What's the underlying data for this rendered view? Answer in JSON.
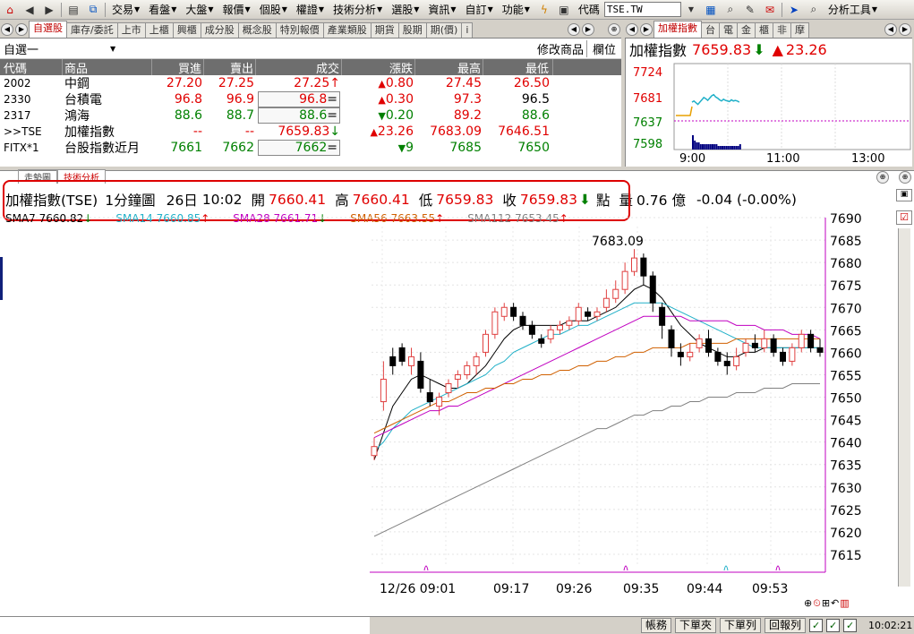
{
  "toolbar": {
    "menus": [
      "交易",
      "看盤",
      "大盤",
      "報價",
      "個股",
      "權證",
      "技術分析",
      "選股",
      "資訊",
      "自訂",
      "功能"
    ],
    "code_label": "代碼",
    "code_value": "TSE.TW",
    "analysis_tools": "分析工具"
  },
  "quote_tabs": [
    "自選股",
    "庫存/委託",
    "上市",
    "上櫃",
    "興櫃",
    "成分股",
    "概念股",
    "特別報價",
    "產業類股",
    "期貨",
    "股期",
    "期(價)",
    "i"
  ],
  "quote_header": {
    "group": "自選一",
    "modify": "修改商品",
    "columns_btn": "欄位"
  },
  "quote_columns": [
    "代碼",
    "商品",
    "買進",
    "賣出",
    "成交",
    "漲跌",
    "最高",
    "最低"
  ],
  "quote_rows": [
    {
      "code": "2002",
      "name": "中鋼",
      "bid": "27.20",
      "ask": "27.25",
      "last": "27.25",
      "last_mark": "↑",
      "chg": "0.80",
      "chg_dir": "up",
      "high": "27.45",
      "low": "26.50",
      "color": "red",
      "hc": "red",
      "lc": "red"
    },
    {
      "code": "2330",
      "name": "台積電",
      "bid": "96.8",
      "ask": "96.9",
      "last": "96.8",
      "last_mark": "=",
      "chg": "0.30",
      "chg_dir": "up",
      "high": "97.3",
      "low": "96.5",
      "color": "red",
      "hc": "red",
      "lc": "blk"
    },
    {
      "code": "2317",
      "name": "鴻海",
      "bid": "88.6",
      "ask": "88.7",
      "last": "88.6",
      "last_mark": "=",
      "chg": "0.20",
      "chg_dir": "down",
      "high": "89.2",
      "low": "88.6",
      "color": "grn",
      "hc": "red",
      "lc": "grn"
    },
    {
      "code": ">>TSE",
      "name": "加權指數",
      "bid": "--",
      "ask": "--",
      "last": "7659.83",
      "last_mark": "↓",
      "chg": "23.26",
      "chg_dir": "up",
      "high": "7683.09",
      "low": "7646.51",
      "color": "red",
      "hc": "red",
      "lc": "red"
    },
    {
      "code": "FITX*1",
      "name": "台股指數近月",
      "bid": "7661",
      "ask": "7662",
      "last": "7662",
      "last_mark": "=",
      "chg": "9",
      "chg_dir": "down",
      "high": "7685",
      "low": "7650",
      "color": "grn",
      "hc": "grn",
      "lc": "grn"
    }
  ],
  "mini_tabs": [
    "加權指數",
    "台",
    "電",
    "金",
    "櫃",
    "非",
    "摩"
  ],
  "mini_header": {
    "name": "加權指數",
    "price": "7659.83",
    "change": "23.26"
  },
  "mini_axis": {
    "y": [
      "7724",
      "7681",
      "7637",
      "7598"
    ],
    "x": [
      "9:00",
      "11:00",
      "13:00"
    ]
  },
  "main_tabs": [
    "走勢圖",
    "技術分析"
  ],
  "info_bar": {
    "title": "加權指數(TSE)",
    "period": "1分鐘圖",
    "date": "26日",
    "time": "10:02",
    "open_label": "開",
    "open": "7660.41",
    "high_label": "高",
    "high": "7660.41",
    "low_label": "低",
    "low": "7659.83",
    "close_label": "收",
    "close": "7659.83",
    "points_label": "點",
    "vol_label": "量",
    "vol": "0.76 億",
    "change": "-0.04 (-0.00%)"
  },
  "ma_legend": [
    {
      "text": "SMA7 7660.82",
      "mark": "↓",
      "color": "#000000"
    },
    {
      "text": "SMA14 7660.85",
      "mark": "↑",
      "color": "#20b0c8"
    },
    {
      "text": "SMA28 7661.71",
      "mark": "↓",
      "color": "#c000c0"
    },
    {
      "text": "SMA56 7663.55",
      "mark": "↑",
      "color": "#d06000"
    },
    {
      "text": "SMA112 7653.45",
      "mark": "↑",
      "color": "#808080"
    }
  ],
  "peak_label": "7683.09",
  "chart_data": {
    "type": "candlestick",
    "y_ticks": [
      7690,
      7685,
      7680,
      7675,
      7670,
      7665,
      7660,
      7655,
      7650,
      7645,
      7640,
      7635,
      7630,
      7625,
      7620,
      7615
    ],
    "ylim": [
      7612,
      7692
    ],
    "x_labels": [
      "12/26 09:01",
      "09:17",
      "09:26",
      "09:35",
      "09:44",
      "09:53"
    ],
    "candles": [
      [
        7637,
        7641,
        7636,
        7639
      ],
      [
        7649,
        7658,
        7647,
        7654
      ],
      [
        7659,
        7661,
        7655,
        7657
      ],
      [
        7661,
        7662,
        7657,
        7658
      ],
      [
        7657,
        7661,
        7655,
        7659
      ],
      [
        7658,
        7660,
        7651,
        7652
      ],
      [
        7651,
        7654,
        7648,
        7649
      ],
      [
        7648,
        7651,
        7646,
        7650
      ],
      [
        7651,
        7654,
        7650,
        7653
      ],
      [
        7654,
        7656,
        7652,
        7655
      ],
      [
        7655,
        7658,
        7654,
        7657
      ],
      [
        7657,
        7660,
        7655,
        7659
      ],
      [
        7660,
        7665,
        7659,
        7664
      ],
      [
        7664,
        7670,
        7663,
        7669
      ],
      [
        7668,
        7671,
        7667,
        7670
      ],
      [
        7670,
        7671,
        7667,
        7668
      ],
      [
        7668,
        7669,
        7665,
        7666
      ],
      [
        7666,
        7667,
        7663,
        7664
      ],
      [
        7663,
        7664,
        7661,
        7662
      ],
      [
        7663,
        7666,
        7662,
        7665
      ],
      [
        7665,
        7667,
        7664,
        7666
      ],
      [
        7666,
        7668,
        7665,
        7667
      ],
      [
        7667,
        7671,
        7666,
        7670
      ],
      [
        7669,
        7670,
        7667,
        7668
      ],
      [
        7668,
        7670,
        7667,
        7669
      ],
      [
        7670,
        7674,
        7669,
        7672
      ],
      [
        7672,
        7676,
        7671,
        7674
      ],
      [
        7674,
        7680,
        7673,
        7678
      ],
      [
        7678,
        7683,
        7677,
        7681
      ],
      [
        7681,
        7682,
        7675,
        7677
      ],
      [
        7677,
        7678,
        7669,
        7671
      ],
      [
        7670,
        7671,
        7663,
        7666
      ],
      [
        7665,
        7666,
        7659,
        7661
      ],
      [
        7660,
        7662,
        7657,
        7659
      ],
      [
        7659,
        7662,
        7658,
        7660
      ],
      [
        7661,
        7664,
        7660,
        7663
      ],
      [
        7663,
        7665,
        7659,
        7660
      ],
      [
        7660,
        7661,
        7657,
        7658
      ],
      [
        7658,
        7660,
        7655,
        7657
      ],
      [
        7657,
        7661,
        7656,
        7659
      ],
      [
        7660,
        7663,
        7659,
        7662
      ],
      [
        7662,
        7664,
        7660,
        7661
      ],
      [
        7661,
        7665,
        7660,
        7663
      ],
      [
        7663,
        7664,
        7659,
        7660
      ],
      [
        7660,
        7661,
        7657,
        7658
      ],
      [
        7658,
        7662,
        7657,
        7661
      ],
      [
        7661,
        7665,
        7660,
        7664
      ],
      [
        7664,
        7665,
        7660,
        7661
      ],
      [
        7661,
        7663,
        7659,
        7660
      ]
    ],
    "sma7": [
      7636,
      7642,
      7648,
      7651,
      7654,
      7655,
      7654,
      7653,
      7652,
      7652,
      7653,
      7655,
      7657,
      7660,
      7663,
      7665,
      7666,
      7666,
      7666,
      7666,
      7666,
      7667,
      7667,
      7667,
      7668,
      7669,
      7670,
      7672,
      7674,
      7675,
      7674,
      7672,
      7669,
      7666,
      7664,
      7662,
      7661,
      7660,
      7659,
      7659,
      7660,
      7660,
      7661,
      7661,
      7661,
      7661,
      7661,
      7661,
      7661
    ],
    "sma14": [
      7638,
      7640,
      7643,
      7645,
      7647,
      7648,
      7649,
      7650,
      7651,
      7652,
      7653,
      7654,
      7655,
      7657,
      7658,
      7660,
      7661,
      7662,
      7663,
      7664,
      7664,
      7665,
      7666,
      7666,
      7667,
      7668,
      7669,
      7670,
      7671,
      7671,
      7671,
      7671,
      7670,
      7669,
      7668,
      7667,
      7666,
      7665,
      7664,
      7663,
      7662,
      7661,
      7661,
      7661,
      7661,
      7661,
      7661,
      7661,
      7661
    ],
    "sma28": [
      7641,
      7642,
      7643,
      7644,
      7645,
      7646,
      7647,
      7647,
      7648,
      7648,
      7649,
      7650,
      7651,
      7652,
      7653,
      7654,
      7655,
      7656,
      7657,
      7658,
      7659,
      7660,
      7661,
      7662,
      7663,
      7664,
      7665,
      7666,
      7667,
      7668,
      7668,
      7668,
      7668,
      7668,
      7667,
      7667,
      7667,
      7667,
      7667,
      7666,
      7666,
      7666,
      7665,
      7665,
      7665,
      7664,
      7664,
      7664,
      7663
    ],
    "sma56": [
      7642,
      7643,
      7644,
      7645,
      7646,
      7647,
      7648,
      7649,
      7649,
      7650,
      7651,
      7651,
      7652,
      7652,
      7653,
      7653,
      7654,
      7654,
      7655,
      7655,
      7656,
      7656,
      7657,
      7657,
      7658,
      7658,
      7659,
      7659,
      7660,
      7660,
      7661,
      7661,
      7661,
      7661,
      7662,
      7662,
      7662,
      7662,
      7662,
      7663,
      7663,
      7663,
      7663,
      7663,
      7663,
      7663,
      7663,
      7663,
      7663
    ],
    "sma112": [
      7619,
      7620,
      7621,
      7622,
      7623,
      7624,
      7625,
      7626,
      7627,
      7628,
      7629,
      7630,
      7631,
      7632,
      7633,
      7634,
      7635,
      7636,
      7637,
      7638,
      7639,
      7640,
      7641,
      7642,
      7643,
      7643,
      7644,
      7645,
      7646,
      7646,
      7647,
      7647,
      7648,
      7648,
      7649,
      7649,
      7650,
      7650,
      7650,
      7651,
      7651,
      7651,
      7652,
      7652,
      7652,
      7653,
      7653,
      7653,
      7653
    ]
  },
  "mini_chart": {
    "price": [
      7668,
      7670,
      7667,
      7664,
      7668,
      7672,
      7676,
      7674,
      7671,
      7675,
      7679,
      7681,
      7677,
      7675,
      7672,
      7670,
      7673,
      7671,
      7670,
      7669,
      7672,
      7670,
      7671,
      7670,
      7668
    ],
    "ref": 7637,
    "volume": [
      8,
      5,
      4,
      4,
      3,
      3,
      3,
      3,
      3,
      3,
      3,
      3,
      3,
      2,
      2,
      2,
      2,
      2,
      2,
      2,
      2,
      2,
      2,
      2,
      3
    ]
  },
  "status_buttons": [
    "帳務",
    "下單夾",
    "下單列",
    "回報列"
  ],
  "clock": "10:02:21",
  "colors": {
    "up": "#e00000",
    "down": "#008000",
    "border_highlight": "#dd0000"
  }
}
